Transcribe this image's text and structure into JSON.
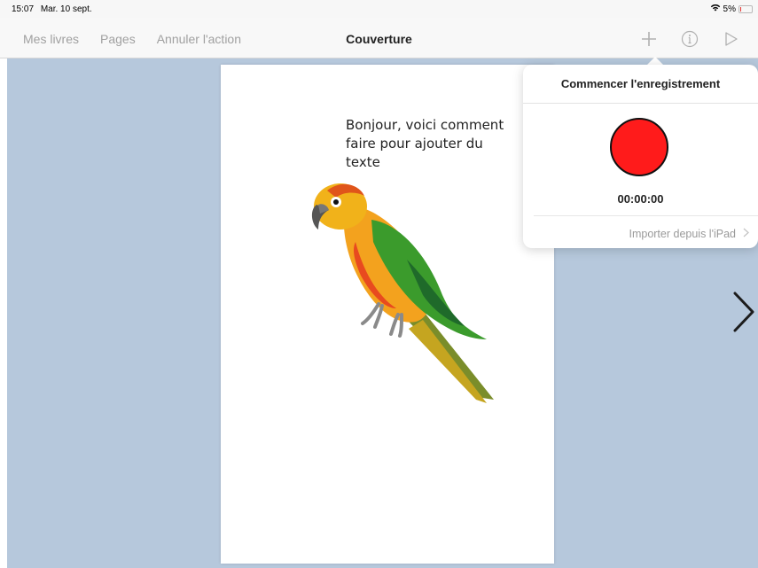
{
  "status": {
    "time": "15:07",
    "date": "Mar. 10 sept.",
    "battery": "5%",
    "battery_level": 0.05
  },
  "nav": {
    "left_items": [
      "Mes livres",
      "Pages",
      "Annuler l'action"
    ],
    "title": "Couverture",
    "icons": [
      "plus-icon",
      "info-icon",
      "play-icon"
    ]
  },
  "page": {
    "text": "Bonjour, voici comment faire pour ajouter du texte"
  },
  "popover": {
    "title": "Commencer l'enregistrement",
    "timer": "00:00:00",
    "import_label": "Importer depuis l'iPad"
  },
  "colors": {
    "canvas": "#b6c8dc",
    "record": "#ff1b1b",
    "nav_text": "#a0a0a0"
  }
}
